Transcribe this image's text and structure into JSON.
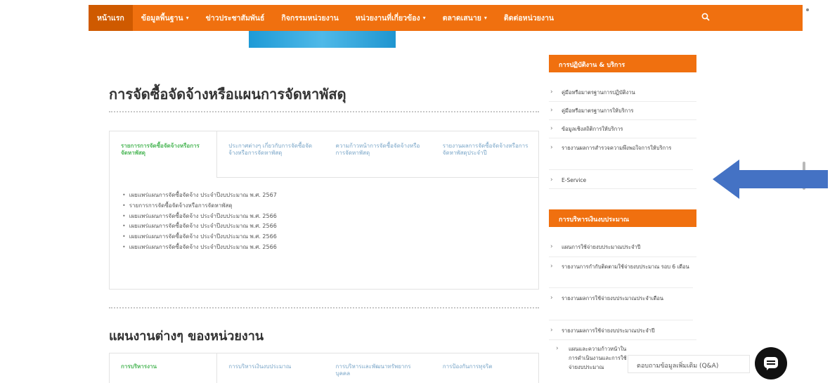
{
  "nav": {
    "items": [
      {
        "label": "หน้าแรก",
        "active": true,
        "dropdown": false
      },
      {
        "label": "ข้อมูลพื้นฐาน",
        "active": false,
        "dropdown": true
      },
      {
        "label": "ข่าวประชาสัมพันธ์",
        "active": false,
        "dropdown": false
      },
      {
        "label": "กิจกรรมหน่วยงาน",
        "active": false,
        "dropdown": false
      },
      {
        "label": "หน่วยงานที่เกี่ยวข้อง",
        "active": false,
        "dropdown": true
      },
      {
        "label": "ตลาดเสนาย",
        "active": false,
        "dropdown": true
      },
      {
        "label": "ติดต่อหน่วยงาน",
        "active": false,
        "dropdown": false
      }
    ],
    "search_icon": "search-icon",
    "color": "#f0700f"
  },
  "procurement": {
    "title": "การจัดซื้อจัดจ้างหรือแผนการจัดหาพัสดุ",
    "tabs": [
      "รายการการจัดซื้อจัดจ้างหรือการจัดหาพัสดุ",
      "ประกาศต่างๆ เกี่ยวกับการจัดซื้อจัดจ้างหรือการจัดหาพัสดุ",
      "ความก้าวหน้าการจัดซื้อจัดจ้างหรือการจัดหาพัสดุ",
      "รายงานผลการจัดซื้อจัดจ้างหรือการจัดหาพัสดุประจำปี"
    ],
    "items": [
      "เผยแพร่แผนการจัดซื้อจัดจ้าง ประจำปีงบประมาณ พ.ศ. 2567",
      "รายการการจัดซื้อจัดจ้างหรือการจัดหาพัสดุ",
      "เผยแพร่แผนการจัดซื้อจัดจ้าง ประจำปีงบประมาณ พ.ศ. 2566",
      "เผยแพร่แผนการจัดซื้อจัดจ้าง ประจำปีงบประมาณ พ.ศ. 2566",
      "เผยแพร่แผนการจัดซื้อจัดจ้าง ประจำปีงบประมาณ พ.ศ. 2566",
      "เผยแพร่แผนการจัดซื้อจัดจ้าง ประจำปีงบประมาณ พ.ศ. 2566"
    ]
  },
  "plans": {
    "title": "แผนงานต่างๆ ของหน่วยงาน",
    "tabs": [
      "การบริหารงาน",
      "การบริหารเงินงบประมาณ",
      "การบริหารและพัฒนาทรัพยากรบุคคล",
      "การป้องกันการทุจริต"
    ]
  },
  "sidebar": {
    "section1": {
      "title": "การปฏิบัติงาน & บริการ",
      "items": [
        "คู่มือหรือมาตรฐานการปฏิบัติงาน",
        "คู่มือหรือมาตรฐานการให้บริการ",
        "ข้อมูลเชิงสถิติการให้บริการ",
        "รายงานผลการสำรวจความพึงพอใจการให้บริการ",
        "E-Service"
      ]
    },
    "section2": {
      "title": "การบริหารเงินงบประมาณ",
      "items": [
        "แผนการใช้จ่ายงบประมาณประจำปี",
        "รายงานการกำกับติดตามใช้จ่ายงบประมาณ รอบ 6 เดือน",
        "รายงานผลการใช้จ่ายงบประมาณประจำเดือน",
        "รายงานผลการใช้จ่ายงบประมาณประจำปี",
        "แผนและความก้าวหน้าในการดำเนินงานและการใช้จ่ายงบประมาณ"
      ]
    }
  },
  "chat": {
    "label": "ตอบถามข้อมูลเพิ่มเติม (Q&A)",
    "icon": "chat-icon"
  },
  "annotation": {
    "arrow_icon": "left-arrow-icon",
    "color": "#4472c4"
  }
}
